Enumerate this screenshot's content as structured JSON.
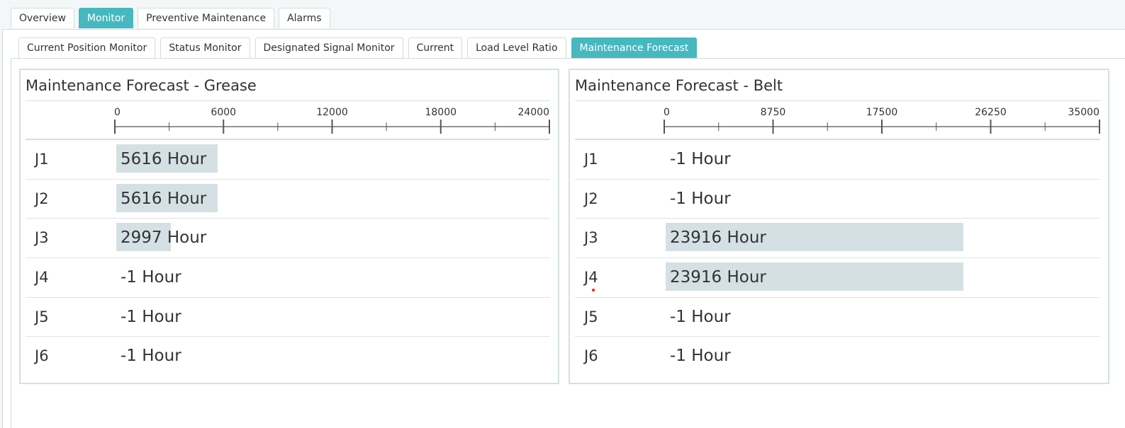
{
  "top_tabs": [
    {
      "label": "Overview",
      "active": false
    },
    {
      "label": "Monitor",
      "active": true
    },
    {
      "label": "Preventive Maintenance",
      "active": false
    },
    {
      "label": "Alarms",
      "active": false
    }
  ],
  "sub_tabs": [
    {
      "label": "Current Position Monitor",
      "active": false
    },
    {
      "label": "Status Monitor",
      "active": false
    },
    {
      "label": "Designated Signal Monitor",
      "active": false
    },
    {
      "label": "Current",
      "active": false
    },
    {
      "label": "Load Level Ratio",
      "active": false
    },
    {
      "label": "Maintenance Forecast",
      "active": true
    }
  ],
  "colors": {
    "accent": "#46b8c0",
    "bar": "#d4e0e4",
    "border": "#d3e0e4",
    "marker": "#e21"
  },
  "chart_data": [
    {
      "type": "bar",
      "title": "Maintenance Forecast - Grease",
      "categories": [
        "J1",
        "J2",
        "J3",
        "J4",
        "J5",
        "J6"
      ],
      "values": [
        5616,
        5616,
        2997,
        -1,
        -1,
        -1
      ],
      "value_labels": [
        "5616 Hour",
        "5616 Hour",
        "2997 Hour",
        "-1 Hour",
        "-1 Hour",
        "-1 Hour"
      ],
      "xlim": [
        0,
        24000
      ],
      "ticks": [
        0,
        6000,
        12000,
        18000,
        24000
      ],
      "tick_labels": [
        "0",
        "6000",
        "12000",
        "18000",
        "24000"
      ],
      "minor_ticks": [
        3000,
        9000,
        15000,
        21000
      ],
      "orientation": "horizontal",
      "axis_position": "top"
    },
    {
      "type": "bar",
      "title": "Maintenance Forecast - Belt",
      "categories": [
        "J1",
        "J2",
        "J3",
        "J4",
        "J5",
        "J6"
      ],
      "values": [
        -1,
        -1,
        23916,
        23916,
        -1,
        -1
      ],
      "value_labels": [
        "-1 Hour",
        "-1 Hour",
        "23916 Hour",
        "23916 Hour",
        "-1 Hour",
        "-1 Hour"
      ],
      "xlim": [
        0,
        35000
      ],
      "ticks": [
        0,
        8750,
        17500,
        26250,
        35000
      ],
      "tick_labels": [
        "0",
        "8750",
        "17500",
        "26250",
        "35000"
      ],
      "minor_ticks": [
        4375,
        13125,
        21875,
        30625
      ],
      "orientation": "horizontal",
      "axis_position": "top"
    }
  ]
}
